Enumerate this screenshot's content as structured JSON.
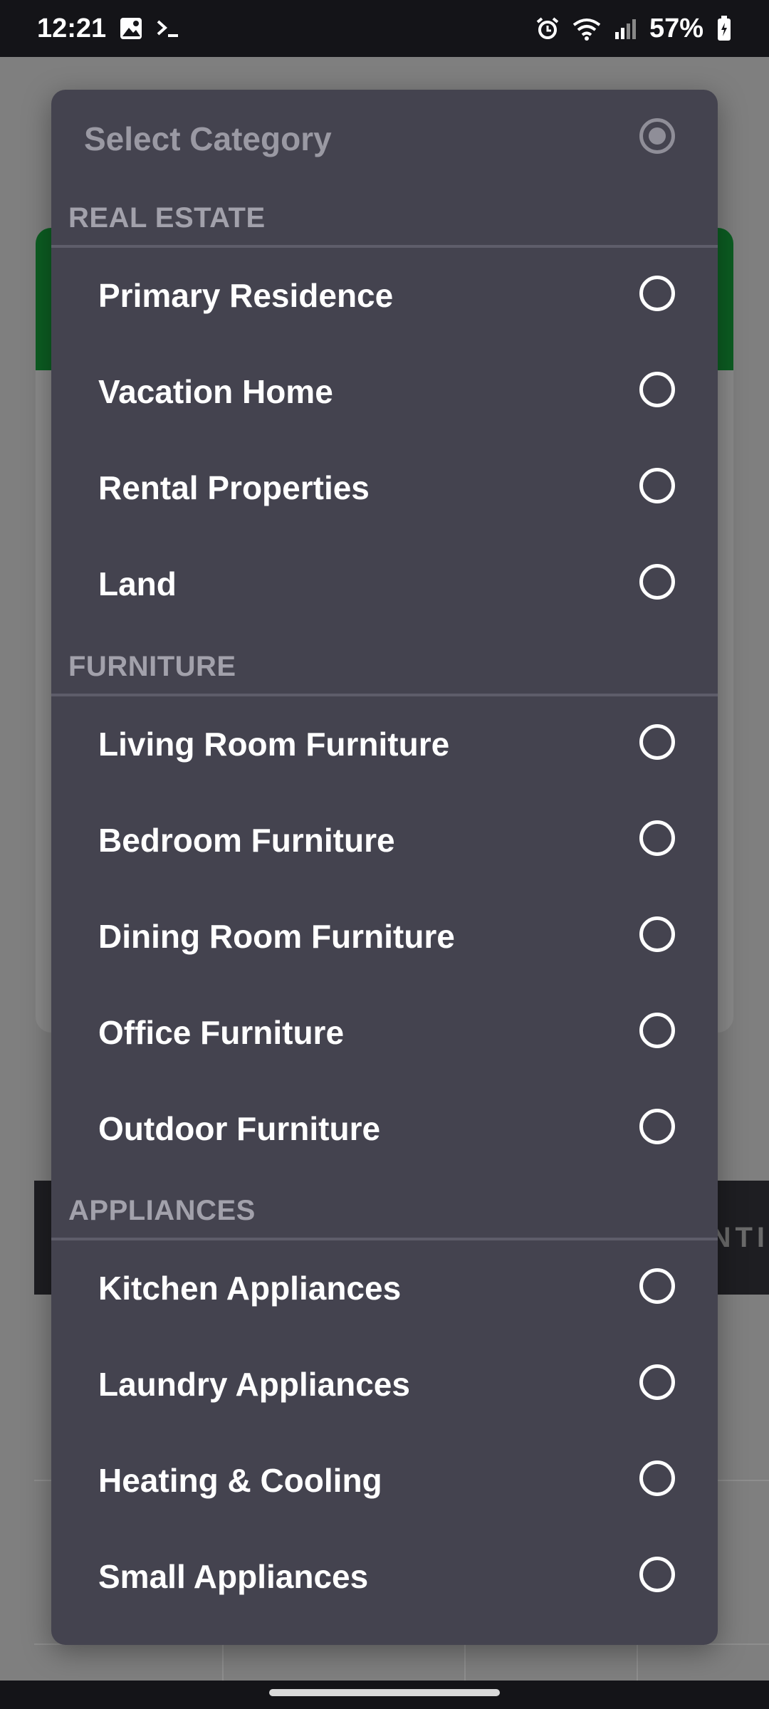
{
  "status_bar": {
    "time": "12:21",
    "battery": "57%",
    "icons_left": [
      "gallery-icon",
      "terminal-icon"
    ],
    "icons_right": [
      "alarm-icon",
      "wifi-icon",
      "signal-icon",
      "battery-icon"
    ]
  },
  "background": {
    "strip_text": "NTI"
  },
  "dialog": {
    "title": "Select Category",
    "sections": [
      {
        "header": "REAL ESTATE",
        "items": [
          "Primary Residence",
          "Vacation Home",
          "Rental Properties",
          "Land"
        ]
      },
      {
        "header": "FURNITURE",
        "items": [
          "Living Room Furniture",
          "Bedroom Furniture",
          "Dining Room Furniture",
          "Office Furniture",
          "Outdoor Furniture"
        ]
      },
      {
        "header": "APPLIANCES",
        "items": [
          "Kitchen Appliances",
          "Laundry Appliances",
          "Heating & Cooling",
          "Small Appliances"
        ]
      }
    ]
  },
  "colors": {
    "dialog_bg": "#44434f",
    "section_header": "#a2a1ab",
    "item_text": "#ffffff",
    "status_bar_bg": "#141418",
    "bg_card_header": "#0c5d22"
  }
}
